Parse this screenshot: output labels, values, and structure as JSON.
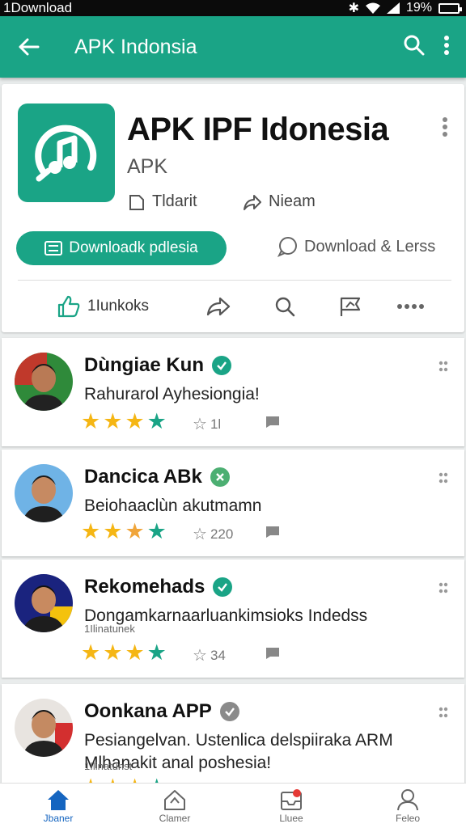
{
  "status_bar": {
    "left_text": "1Download",
    "battery_text": "19%"
  },
  "app_bar": {
    "title": "APK Indonsia"
  },
  "hero": {
    "app_title": "APK IPF Idonesia",
    "app_subtitle": "APK",
    "meta_1": "Tldarit",
    "meta_2": "Nieam",
    "download_button": "Downloadk pdlesia",
    "download_link": "Download & Lerss",
    "like_label": "1Iunkoks"
  },
  "reviews": [
    {
      "name": "Dùngiae Kun",
      "text": "Rahurarol Ayhesiongia!",
      "sub": "",
      "stars": 4.5,
      "likes": "1l",
      "badge_color": "#1aa486"
    },
    {
      "name": "Dancica ABk",
      "text": "Beiohaaclùn akutmamn",
      "sub": "",
      "stars": 4.5,
      "likes": "220",
      "badge_color": "#4caf72"
    },
    {
      "name": "Rekomehads",
      "text": "Dongamkarnaarluankimsioks Indedss",
      "sub": "1Ilinatunek",
      "stars": 4.5,
      "likes": "34",
      "badge_color": "#1aa486"
    },
    {
      "name": "Oonkana APP",
      "text": "Pesiangelvan. Ustenlica delspiiraka ARM Mlhanakit anal poshesia!",
      "sub": "1Ilinatunst",
      "stars": 4.5,
      "likes": "",
      "badge_color": "#8a8a8a"
    }
  ],
  "bottom_nav": [
    {
      "label": "Jbaner",
      "icon": "home-icon",
      "active": true
    },
    {
      "label": "Clamer",
      "icon": "discover-icon",
      "active": false
    },
    {
      "label": "Lluee",
      "icon": "inbox-icon",
      "active": false
    },
    {
      "label": "Feleo",
      "icon": "profile-icon",
      "active": false
    }
  ],
  "colors": {
    "brand": "#1aa486",
    "star": "#f5b614",
    "active_nav": "#1565c0"
  }
}
